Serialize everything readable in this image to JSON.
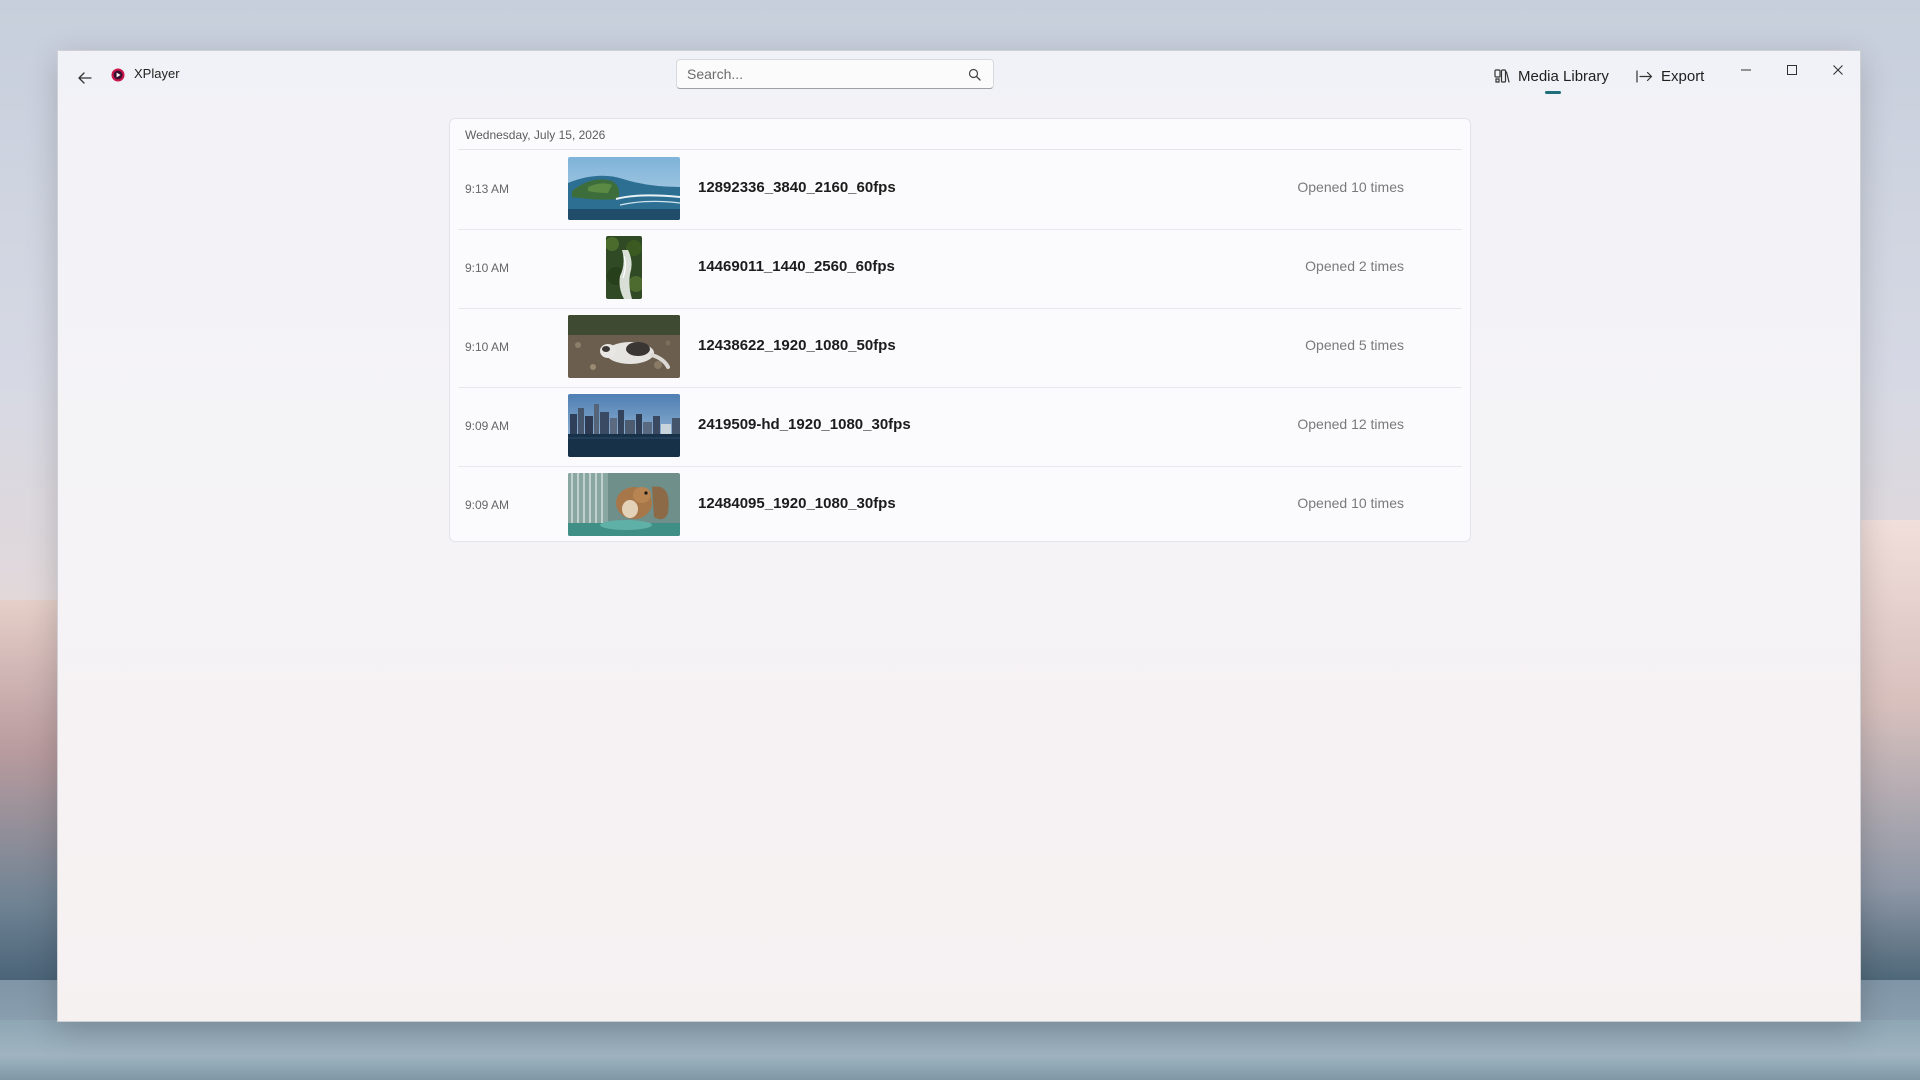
{
  "app": {
    "title": "XPlayer"
  },
  "search": {
    "placeholder": "Search..."
  },
  "nav": {
    "media_library": "Media Library",
    "export": "Export",
    "active": "media_library"
  },
  "colors": {
    "accent": "#1e6f7a",
    "logo": "#c8174b"
  },
  "history": {
    "date": "Wednesday, July 15, 2026",
    "items": [
      {
        "time": "9:13 AM",
        "name": "12892336_3840_2160_60fps",
        "opened": "Opened 10 times",
        "thumb": "coast-aerial"
      },
      {
        "time": "9:10 AM",
        "name": "14469011_1440_2560_60fps",
        "opened": "Opened 2 times",
        "thumb": "forest-waterfall"
      },
      {
        "time": "9:10 AM",
        "name": "12438622_1920_1080_50fps",
        "opened": "Opened 5 times",
        "thumb": "cat-lying"
      },
      {
        "time": "9:09 AM",
        "name": "2419509-hd_1920_1080_30fps",
        "opened": "Opened 12 times",
        "thumb": "city-skyline"
      },
      {
        "time": "9:09 AM",
        "name": "12484095_1920_1080_30fps",
        "opened": "Opened 10 times",
        "thumb": "squirrel"
      }
    ]
  }
}
